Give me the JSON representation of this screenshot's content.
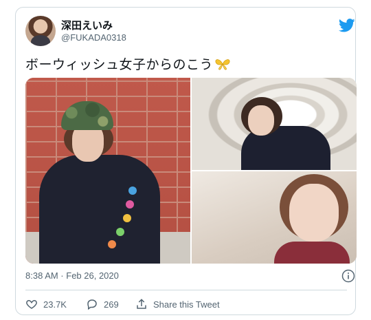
{
  "user": {
    "display_name": "深田えいみ",
    "handle": "@FUKADA0318"
  },
  "tweet": {
    "text": "ボーウィッシュ女子からのこう",
    "emoji": "yellow-butterfly-icon",
    "timestamp": "8:38 AM · Feb 26, 2020"
  },
  "actions": {
    "likes": "23.7K",
    "replies": "269",
    "share_label": "Share this Tweet"
  },
  "colors": {
    "brand": "#1d9bf0",
    "muted": "#536471",
    "border": "#cfd9de"
  }
}
